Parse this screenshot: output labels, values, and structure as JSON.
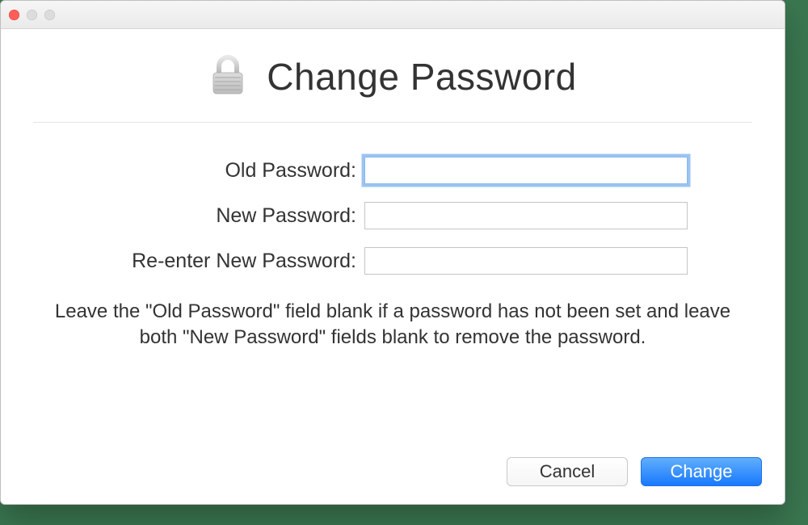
{
  "dialog": {
    "title": "Change Password",
    "fields": {
      "old_label": "Old Password:",
      "new_label": "New Password:",
      "reenter_label": "Re-enter New Password:",
      "old_value": "",
      "new_value": "",
      "reenter_value": ""
    },
    "hint": "Leave the \"Old Password\" field blank if a password has not been set and leave both \"New Password\" fields blank to remove the password.",
    "buttons": {
      "cancel": "Cancel",
      "change": "Change"
    }
  }
}
